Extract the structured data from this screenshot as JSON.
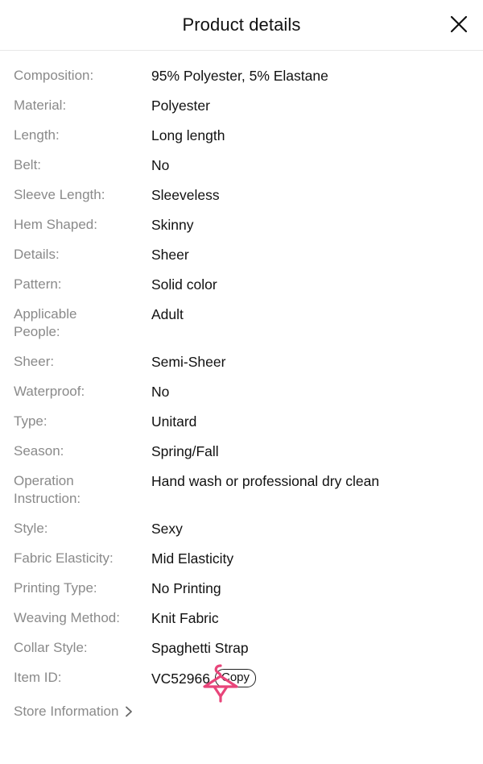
{
  "header": {
    "title": "Product details",
    "close_icon": "close-icon"
  },
  "details": [
    {
      "label": "Composition:",
      "value": "95% Polyester, 5% Elastane"
    },
    {
      "label": "Material:",
      "value": "Polyester"
    },
    {
      "label": "Length:",
      "value": "Long length"
    },
    {
      "label": "Belt:",
      "value": "No"
    },
    {
      "label": "Sleeve Length:",
      "value": "Sleeveless"
    },
    {
      "label": "Hem Shaped:",
      "value": "Skinny"
    },
    {
      "label": "Details:",
      "value": "Sheer"
    },
    {
      "label": "Pattern:",
      "value": "Solid color"
    },
    {
      "label": "Applicable People:",
      "value": "Adult"
    },
    {
      "label": "Sheer:",
      "value": "Semi-Sheer"
    },
    {
      "label": "Waterproof:",
      "value": "No"
    },
    {
      "label": "Type:",
      "value": "Unitard"
    },
    {
      "label": "Season:",
      "value": "Spring/Fall"
    },
    {
      "label": "Operation Instruction:",
      "value": "Hand wash or professional dry clean"
    },
    {
      "label": "Style:",
      "value": "Sexy"
    },
    {
      "label": "Fabric Elasticity:",
      "value": "Mid Elasticity"
    },
    {
      "label": "Printing Type:",
      "value": "No Printing"
    },
    {
      "label": "Weaving Method:",
      "value": "Knit Fabric"
    },
    {
      "label": "Collar Style:",
      "value": "Spaghetti Strap"
    }
  ],
  "item_id": {
    "label": "Item ID:",
    "value": "VC52966",
    "copy_label": "Copy",
    "overlay_icon": "hanger-icon"
  },
  "store": {
    "label": "Store Information",
    "chevron_icon": "chevron-right-icon"
  },
  "colors": {
    "label_gray": "#8a8a8a",
    "text": "#111111",
    "hanger_pink": "#e8457a"
  }
}
